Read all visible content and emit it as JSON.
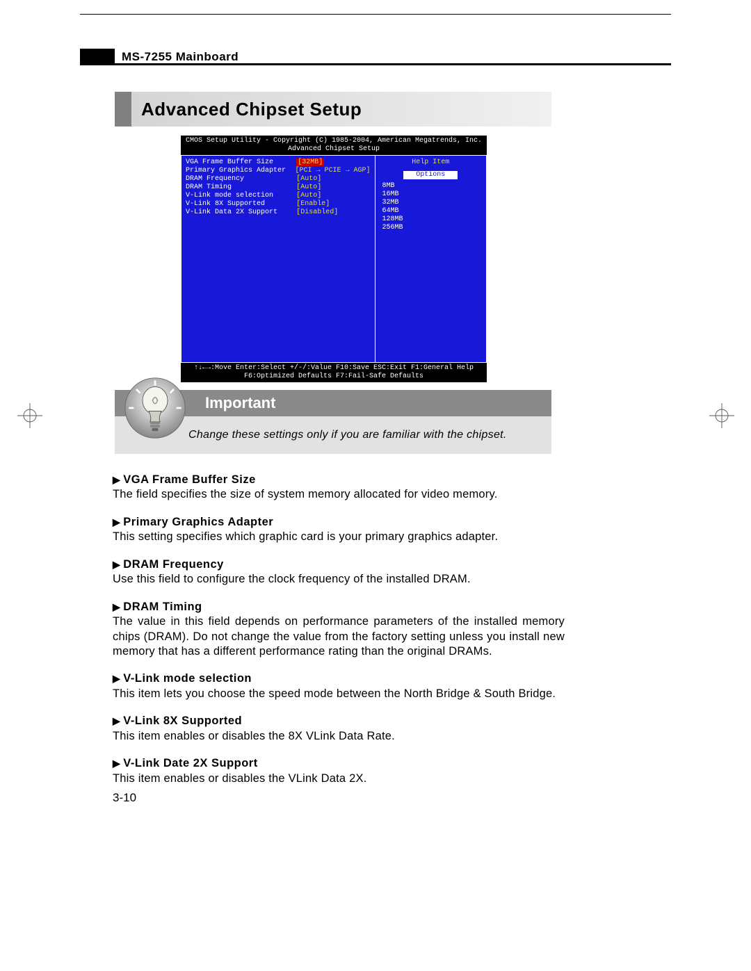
{
  "header": {
    "title": "MS-7255 Mainboard"
  },
  "section": {
    "title": "Advanced Chipset Setup"
  },
  "bios": {
    "top_line1": "CMOS Setup Utility - Copyright (C) 1985-2004, American Megatrends, Inc.",
    "top_line2": "Advanced Chipset Setup",
    "settings": [
      {
        "label": "VGA Frame Buffer Size",
        "value": "[32MB]",
        "selected": true
      },
      {
        "label": "Primary Graphics Adapter",
        "value": "[PCI → PCIE → AGP]"
      },
      {
        "label": "DRAM Frequency",
        "value": "[Auto]"
      },
      {
        "label": "DRAM Timing",
        "value": "[Auto]"
      },
      {
        "label": "V-Link mode selection",
        "value": "[Auto]"
      },
      {
        "label": "V-Link 8X Supported",
        "value": "[Enable]"
      },
      {
        "label": "V-Link Data 2X Support",
        "value": "[Disabled]"
      }
    ],
    "help_title": "Help Item",
    "options_label": "Options",
    "options": [
      "8MB",
      "16MB",
      "32MB",
      "64MB",
      "128MB",
      "256MB"
    ],
    "footer1": "↑↓←→:Move  Enter:Select  +/-/:Value  F10:Save  ESC:Exit  F1:General Help",
    "footer2": "F6:Optimized Defaults    F7:Fail-Safe Defaults"
  },
  "important": {
    "title": "Important",
    "text": "Change these settings only if you are familiar with the chipset."
  },
  "fields": [
    {
      "title": "VGA Frame Buffer Size",
      "desc": "The field specifies the size of system memory allocated for video memory."
    },
    {
      "title": "Primary Graphics Adapter",
      "desc": "This setting specifies which graphic card is your primary graphics adapter."
    },
    {
      "title": "DRAM Frequency",
      "desc": "Use this field to configure the clock frequency of the installed DRAM."
    },
    {
      "title": "DRAM Timing",
      "desc": "The value in this field depends on performance parameters of the installed memory chips (DRAM). Do not change the value from the factory setting unless you install new memory that has a different performance rating than the original DRAMs."
    },
    {
      "title": "V-Link mode selection",
      "desc": "This item lets you choose the speed mode between the North Bridge & South Bridge."
    },
    {
      "title": "V-Link 8X Supported",
      "desc": "This item enables or disables the 8X VLink Data Rate."
    },
    {
      "title": "V-Link Date 2X Support",
      "desc": "This item enables or disables the VLink Data 2X."
    }
  ],
  "page_number": "3-10"
}
